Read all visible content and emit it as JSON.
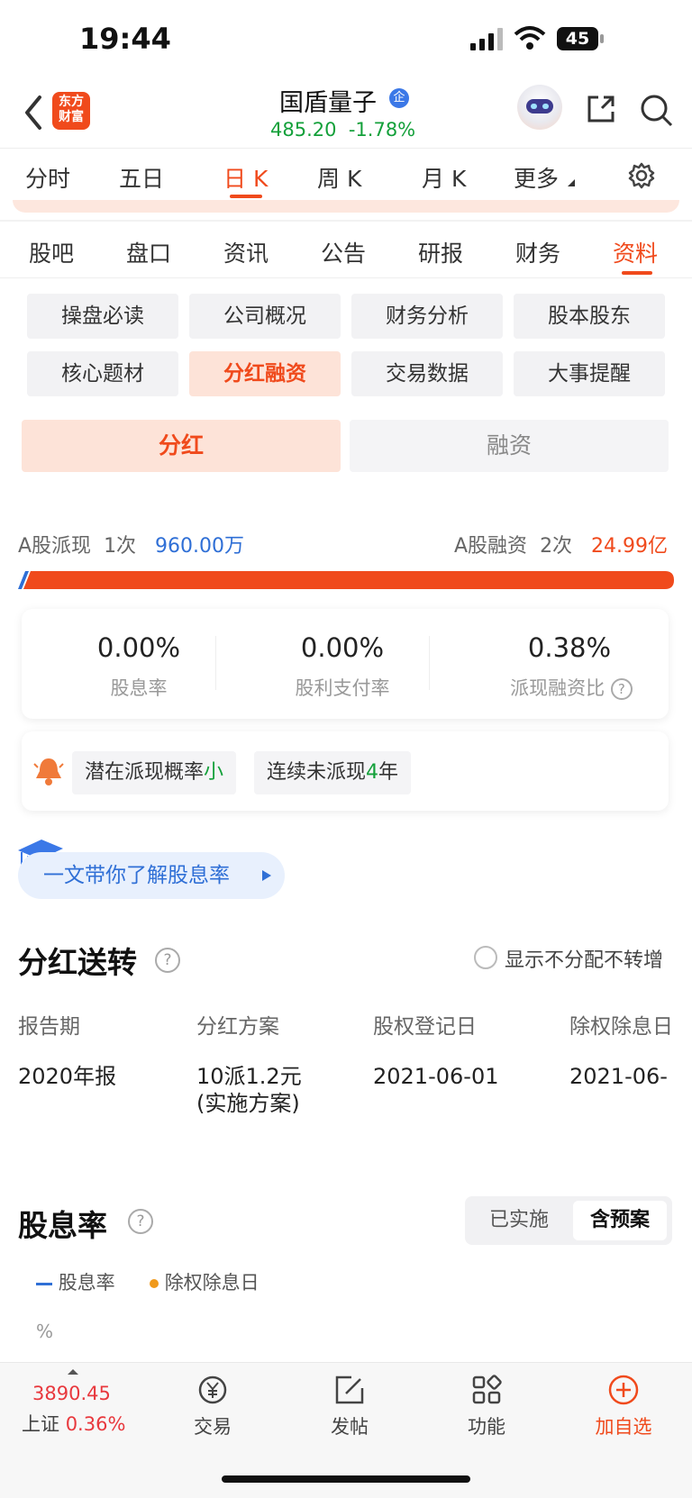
{
  "status": {
    "time": "19:44",
    "battery": "45"
  },
  "header": {
    "logo_line1": "东方",
    "logo_line2": "财富",
    "stock_name": "国盾量子",
    "stock_badge": "企",
    "price": "485.20",
    "change": "-1.78%",
    "price_color": "#13a03a"
  },
  "ktabs": [
    "分时",
    "五日",
    "日 K",
    "周 K",
    "月 K",
    "更多"
  ],
  "main_tabs": [
    "股吧",
    "盘口",
    "资讯",
    "公告",
    "研报",
    "财务",
    "资料"
  ],
  "chips": [
    "操盘必读",
    "公司概况",
    "财务分析",
    "股本股东",
    "核心题材",
    "分红融资",
    "交易数据",
    "大事提醒"
  ],
  "segments": {
    "on": "分红",
    "off": "融资"
  },
  "summary": {
    "left_label": "A股派现",
    "left_count": "1次",
    "left_value": "960.00万",
    "right_label": "A股融资",
    "right_count": "2次",
    "right_value": "24.99亿",
    "payout_ratio": 0.0038
  },
  "metrics": [
    {
      "value": "0.00%",
      "label": "股息率"
    },
    {
      "value": "0.00%",
      "label": "股利支付率"
    },
    {
      "value": "0.38%",
      "label": "派现融资比"
    }
  ],
  "tags": {
    "t1_prefix": "潜在派现概率",
    "t1_value": "小",
    "t2_prefix": "连续未派现",
    "t2_value": "4",
    "t2_suffix": "年"
  },
  "learn_link": "一文带你了解股息率",
  "dividend_section": {
    "title": "分红送转",
    "option_label": "显示不分配不转增",
    "columns": [
      "报告期",
      "分红方案",
      "股权登记日",
      "除权除息日"
    ],
    "rows": [
      {
        "period": "2020年报",
        "plan_line1": "10派1.2元",
        "plan_line2": "(实施方案)",
        "record_date": "2021-06-01",
        "ex_date": "2021-06-"
      }
    ]
  },
  "yield_section": {
    "title": "股息率",
    "toggle_off": "已实施",
    "toggle_on": "含预案",
    "legend_line": "股息率",
    "legend_dot": "除权除息日",
    "unit": "%"
  },
  "bottom_nav": {
    "index_value": "3890.45",
    "index_name": "上证",
    "index_change": "0.36%",
    "items": [
      "交易",
      "发帖",
      "功能",
      "加自选"
    ]
  },
  "colors": {
    "accent": "#f04a1c",
    "blue": "#2f6fd6",
    "green": "#13a03a",
    "red": "#e8383d"
  }
}
